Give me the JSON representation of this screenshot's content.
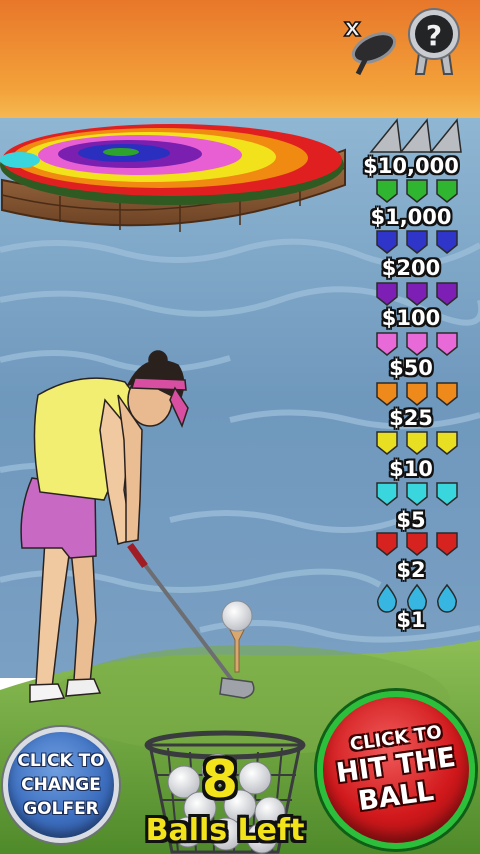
{
  "payout_table": [
    {
      "label": "$10,000",
      "marker": "triangle",
      "color": "#b9bcc1"
    },
    {
      "label": "$1,000",
      "marker": "gem",
      "color": "#2fb52f"
    },
    {
      "label": "$200",
      "marker": "gem",
      "color": "#2f35c9"
    },
    {
      "label": "$100",
      "marker": "gem",
      "color": "#7d1fb5"
    },
    {
      "label": "$50",
      "marker": "gem",
      "color": "#e86ad8"
    },
    {
      "label": "$25",
      "marker": "gem",
      "color": "#ee8a1c"
    },
    {
      "label": "$10",
      "marker": "gem",
      "color": "#e8de22"
    },
    {
      "label": "$5",
      "marker": "gem",
      "color": "#39d7dd"
    },
    {
      "label": "$2",
      "marker": "gem",
      "color": "#d6231f"
    },
    {
      "label": "$1",
      "marker": "drop",
      "color": "#36b6e0"
    }
  ],
  "target_rings": [
    "#e02020",
    "#f08a10",
    "#f2e21c",
    "#e75fd3",
    "#7a1fb0",
    "#2a2fc0",
    "#2da32d"
  ],
  "buttons": {
    "change_golfer": [
      "CLICK TO",
      "CHANGE",
      "GOLFER"
    ],
    "hit_ball": [
      "CLICK TO",
      "HIT THE",
      "BALL"
    ]
  },
  "balls": {
    "count": "8",
    "label": "Balls Left"
  },
  "icons": {
    "close": "close-x-icon",
    "help": "question-mark-icon"
  }
}
